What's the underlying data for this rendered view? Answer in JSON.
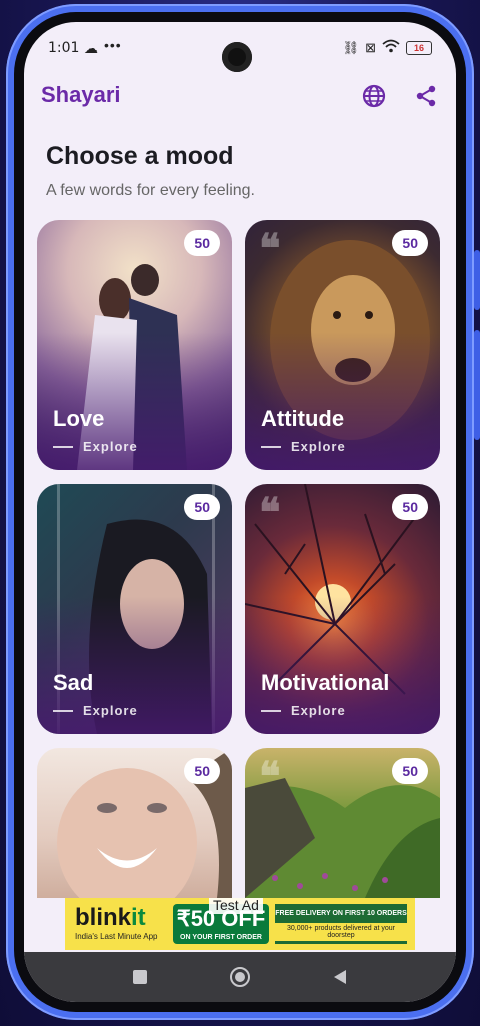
{
  "status_bar": {
    "time": "1:01",
    "battery": "16"
  },
  "app": {
    "title": "Shayari"
  },
  "header": {
    "title": "Choose a mood",
    "subtitle": "A few words for every feeling."
  },
  "cards": [
    {
      "title": "Love",
      "count": "50",
      "explore": "Explore"
    },
    {
      "title": "Attitude",
      "count": "50",
      "explore": "Explore"
    },
    {
      "title": "Sad",
      "count": "50",
      "explore": "Explore"
    },
    {
      "title": "Motivational",
      "count": "50",
      "explore": "Explore"
    },
    {
      "title": "",
      "count": "50",
      "explore": ""
    },
    {
      "title": "",
      "count": "50",
      "explore": ""
    }
  ],
  "ad": {
    "label": "Test Ad",
    "brand_a": "blink",
    "brand_b": "it",
    "tagline": "India's Last Minute App",
    "offer": "₹50 OFF",
    "offer_sub": "ON YOUR FIRST ORDER",
    "delivery": "FREE DELIVERY ON FIRST 10 ORDERS",
    "products": "30,000+ products delivered at your doorstep"
  },
  "colors": {
    "primary": "#6b2aa8",
    "background": "#f3eef9",
    "badge_text": "#5b2aa0"
  },
  "icons": {
    "globe": "globe-icon",
    "share": "share-icon"
  }
}
